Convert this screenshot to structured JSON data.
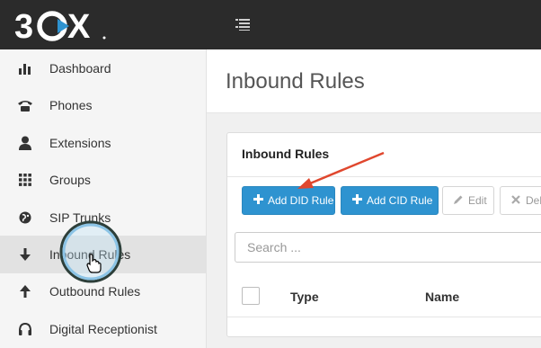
{
  "brand": {
    "logo_text": "3CX",
    "colors": {
      "topbar": "#2b2b2b",
      "primary": "#2e93d0",
      "arrow": "#e0472e",
      "cursor_ring": "#2d3f3a"
    }
  },
  "topbar": {
    "menu_icon": "menu-lines-icon"
  },
  "sidebar": {
    "items": [
      {
        "label": "Dashboard",
        "icon": "bar-chart-icon"
      },
      {
        "label": "Phones",
        "icon": "phone-icon"
      },
      {
        "label": "Extensions",
        "icon": "user-icon"
      },
      {
        "label": "Groups",
        "icon": "grid-icon"
      },
      {
        "label": "SIP Trunks",
        "icon": "globe-icon"
      },
      {
        "label": "Inbound Rules",
        "icon": "arrow-down-icon",
        "active": true
      },
      {
        "label": "Outbound Rules",
        "icon": "arrow-up-icon"
      },
      {
        "label": "Digital Receptionist",
        "icon": "headset-icon"
      }
    ]
  },
  "main": {
    "page_title": "Inbound Rules",
    "panel": {
      "title": "Inbound Rules",
      "toolbar": {
        "add_did_label": "Add DID Rule",
        "add_cid_label": "Add CID Rule",
        "edit_label": "Edit",
        "delete_label": "Dele"
      },
      "search": {
        "placeholder": "Search ...",
        "value": ""
      },
      "table": {
        "columns": [
          "Type",
          "Name"
        ]
      }
    }
  }
}
